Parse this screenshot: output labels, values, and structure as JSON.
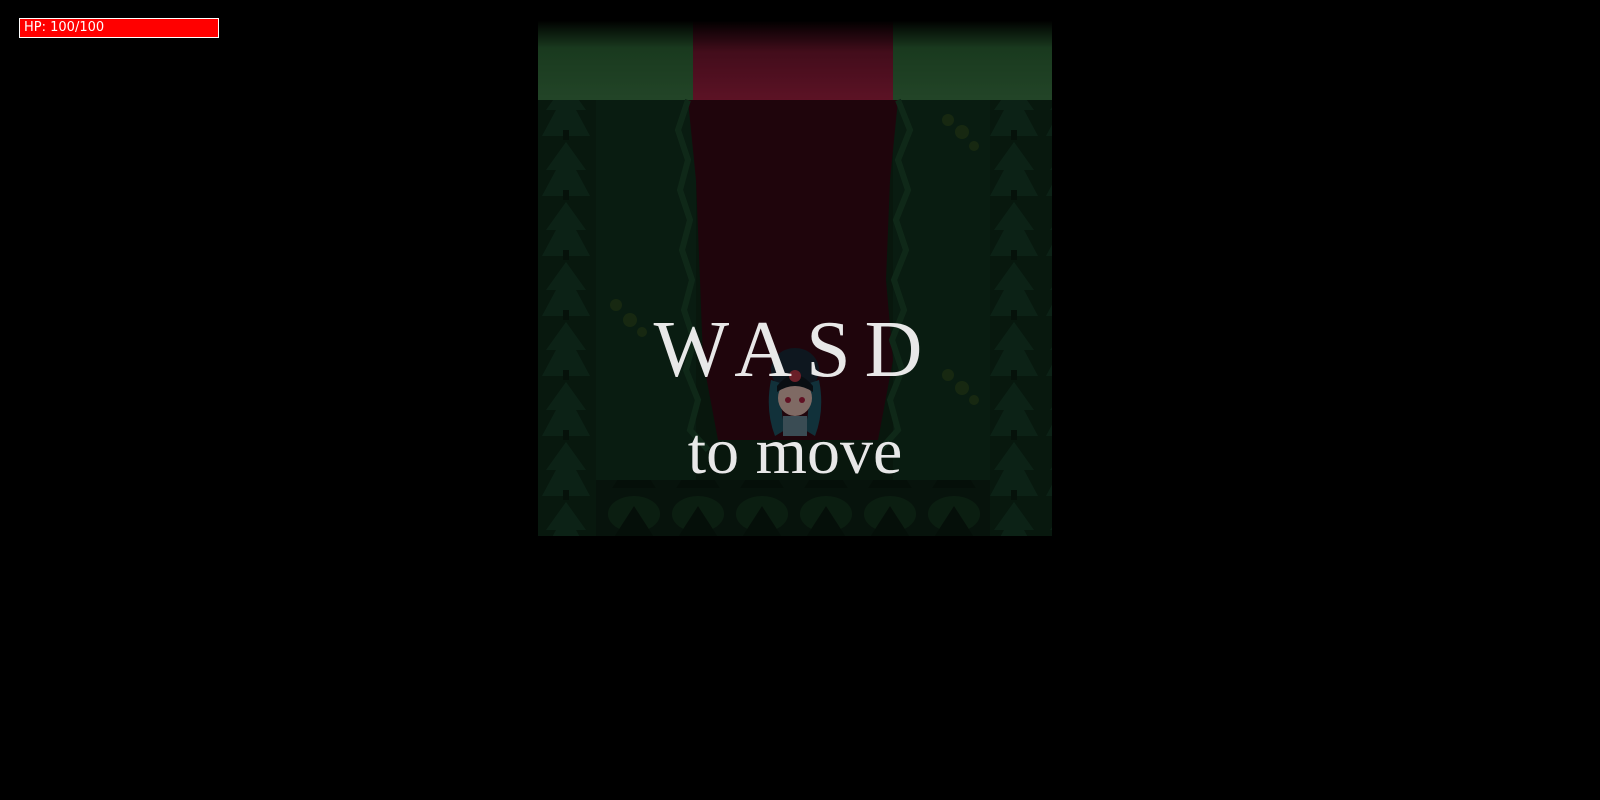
{
  "hud": {
    "hp_text": "HP: 100/100",
    "hp_current": 100,
    "hp_max": 100,
    "hp_fill_fraction": 1.0,
    "hp_color": "#ff0000",
    "hp_border_color": "#ffffff"
  },
  "overlay": {
    "keys_text": "WASD",
    "action_text": "to move",
    "text_color": "#e8e8e8"
  },
  "scene": {
    "sky_color": "#3d7a45",
    "path_color": "#3a0a14",
    "path_top_color": "#a31f3f",
    "forest_color": "#10301d",
    "tree_color": "#1a4a2e",
    "player_icon": "girl-character-icon"
  }
}
